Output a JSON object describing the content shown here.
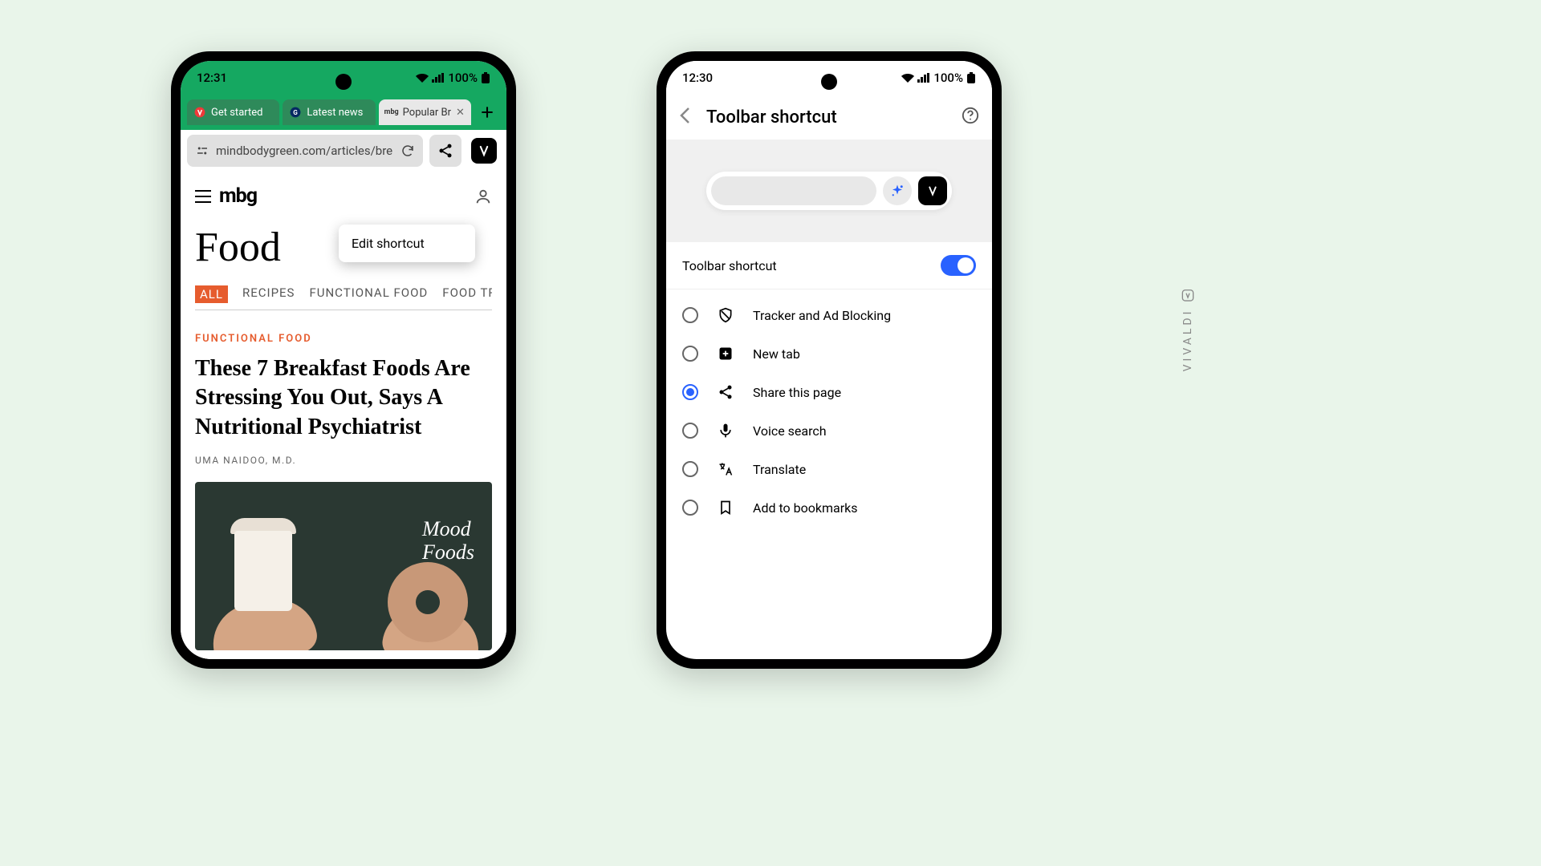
{
  "left_phone": {
    "status": {
      "time": "12:31",
      "battery": "100%"
    },
    "tabs": [
      {
        "label": "Get started",
        "favicon": "vivaldi"
      },
      {
        "label": "Latest news",
        "favicon": "guardian"
      },
      {
        "label": "Popular Br",
        "favicon": "mbg",
        "active": true
      }
    ],
    "url": "mindbodygreen.com/articles/bre",
    "popup": "Edit shortcut",
    "page": {
      "logo": "mbg",
      "section": "Food",
      "tabs": [
        "ALL",
        "RECIPES",
        "FUNCTIONAL FOOD",
        "FOOD TR"
      ],
      "article": {
        "category": "FUNCTIONAL FOOD",
        "title": "These 7 Breakfast Foods Are Stressing You Out, Says A Nutritional Psychiatrist",
        "author": "UMA NAIDOO, M.D.",
        "image_overlay": "Mood\nFoods"
      }
    }
  },
  "right_phone": {
    "status": {
      "time": "12:30",
      "battery": "100%"
    },
    "title": "Toolbar shortcut",
    "toggle_label": "Toolbar shortcut",
    "toggle_on": true,
    "shortcuts": [
      {
        "label": "Tracker and Ad Blocking",
        "icon": "shield",
        "selected": false
      },
      {
        "label": "New tab",
        "icon": "plus",
        "selected": false
      },
      {
        "label": "Share this page",
        "icon": "share",
        "selected": true
      },
      {
        "label": "Voice search",
        "icon": "mic",
        "selected": false
      },
      {
        "label": "Translate",
        "icon": "translate",
        "selected": false
      },
      {
        "label": "Add to bookmarks",
        "icon": "bookmark",
        "selected": false
      }
    ]
  },
  "watermark": "VIVALDI"
}
